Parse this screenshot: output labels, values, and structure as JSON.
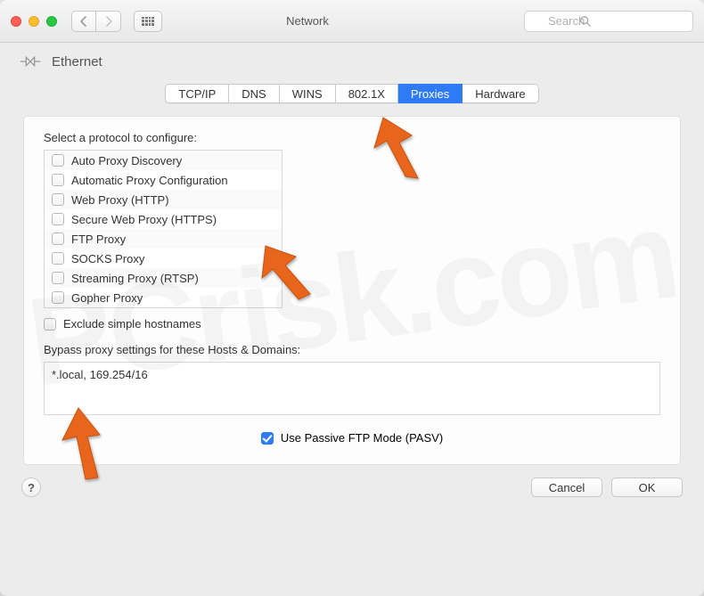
{
  "window": {
    "title": "Network"
  },
  "search": {
    "placeholder": "Search"
  },
  "header": {
    "interface": "Ethernet"
  },
  "tabs": [
    {
      "label": "TCP/IP",
      "active": false
    },
    {
      "label": "DNS",
      "active": false
    },
    {
      "label": "WINS",
      "active": false
    },
    {
      "label": "802.1X",
      "active": false
    },
    {
      "label": "Proxies",
      "active": true
    },
    {
      "label": "Hardware",
      "active": false
    }
  ],
  "proxies": {
    "select_protocol_label": "Select a protocol to configure:",
    "protocols": [
      {
        "label": "Auto Proxy Discovery",
        "checked": false
      },
      {
        "label": "Automatic Proxy Configuration",
        "checked": false
      },
      {
        "label": "Web Proxy (HTTP)",
        "checked": false
      },
      {
        "label": "Secure Web Proxy (HTTPS)",
        "checked": false
      },
      {
        "label": "FTP Proxy",
        "checked": false
      },
      {
        "label": "SOCKS Proxy",
        "checked": false
      },
      {
        "label": "Streaming Proxy (RTSP)",
        "checked": false
      },
      {
        "label": "Gopher Proxy",
        "checked": false
      }
    ],
    "exclude_simple_label": "Exclude simple hostnames",
    "exclude_simple_checked": false,
    "bypass_label": "Bypass proxy settings for these Hosts & Domains:",
    "bypass_value": "*.local, 169.254/16",
    "pasv_label": "Use Passive FTP Mode (PASV)",
    "pasv_checked": true
  },
  "footer": {
    "help": "?",
    "cancel": "Cancel",
    "ok": "OK"
  },
  "watermark": "PCrisk.com",
  "colors": {
    "accent": "#2f7bf6",
    "annotation_arrow": "#e8651f"
  }
}
